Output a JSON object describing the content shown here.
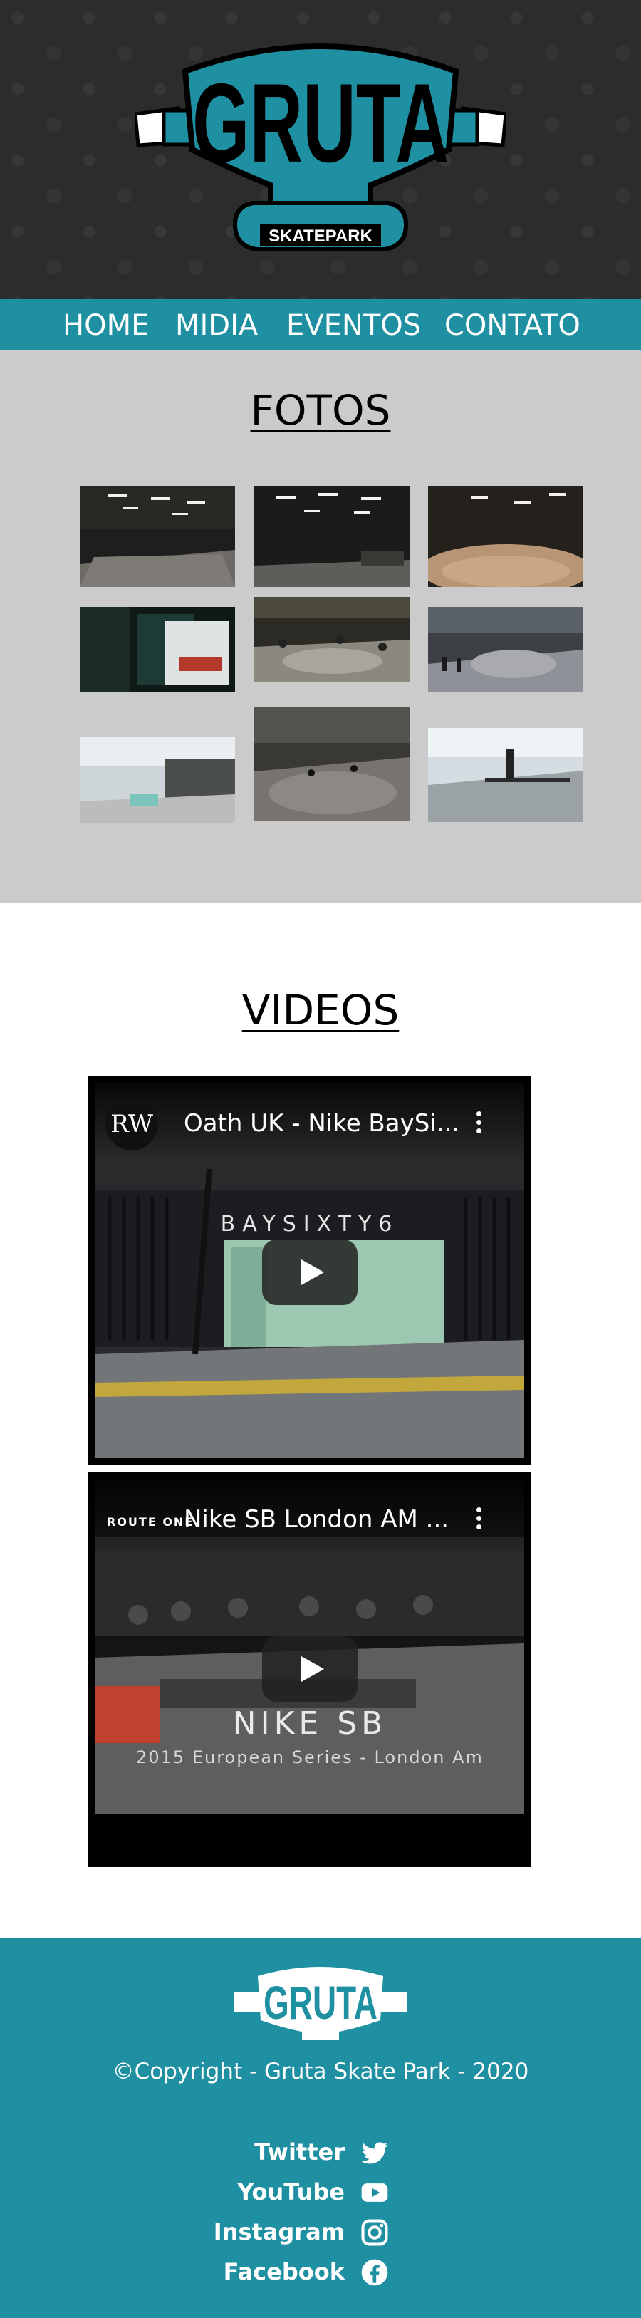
{
  "brand": {
    "logo_text": "GRUTA",
    "logo_subtext": "SKATEPARK",
    "accent": "#1f8fa2",
    "header_bg": "#2d2c2c"
  },
  "nav": {
    "items": [
      {
        "label": "HOME"
      },
      {
        "label": "MIDIA"
      },
      {
        "label": "EVENTOS"
      },
      {
        "label": "CONTATO"
      }
    ]
  },
  "fotos": {
    "title": "FOTOS",
    "bg": "#cbcbcb",
    "photo_count": 9
  },
  "videos": {
    "title": "VIDEOS",
    "items": [
      {
        "channel_badge": "RW",
        "title": "Oath UK - Nike BaySi...",
        "overlay_text": "BAYSIXTY6"
      },
      {
        "channel_badge": "ROUTE ONE",
        "title": "Nike SB London AM ...",
        "overlay_text": "NIKE SB",
        "overlay_subtext": "2015 European Series - London Am"
      }
    ]
  },
  "footer": {
    "logo_text": "GRUTA",
    "copyright": "©Copyright - Gruta Skate Park - 2020",
    "social": [
      {
        "label": "Twitter",
        "icon": "twitter-icon"
      },
      {
        "label": "YouTube",
        "icon": "youtube-icon"
      },
      {
        "label": "Instagram",
        "icon": "instagram-icon"
      },
      {
        "label": "Facebook",
        "icon": "facebook-icon"
      }
    ]
  }
}
